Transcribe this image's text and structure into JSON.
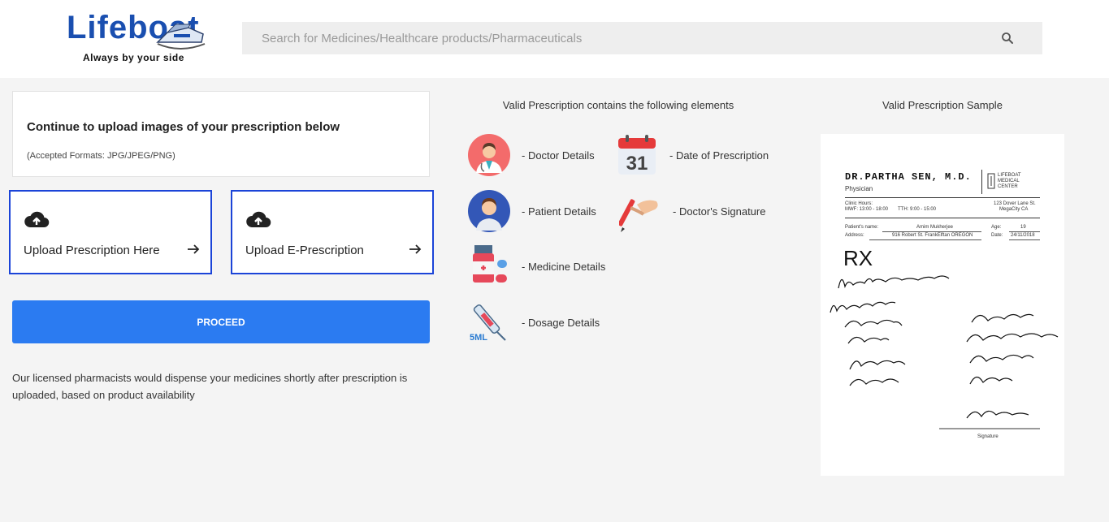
{
  "brand": {
    "name": "Lifeboat",
    "tagline": "Always by your side",
    "color": "#1a4fb0"
  },
  "search": {
    "placeholder": "Search for Medicines/Healthcare products/Pharmaceuticals",
    "icon": "search-icon"
  },
  "upload": {
    "heading": "Continue to upload images of your prescription below",
    "formats": "(Accepted Formats: JPG/JPEG/PNG)",
    "buttons": [
      {
        "label": "Upload Prescription Here",
        "icon": "cloud-upload-icon"
      },
      {
        "label": "Upload E-Prescription",
        "icon": "cloud-upload-icon"
      }
    ],
    "proceed_label": "PROCEED",
    "note": "Our licensed pharmacists would dispense your medicines shortly after prescription is uploaded, based on product availability"
  },
  "elements": {
    "title": "Valid Prescription contains the following elements",
    "items": [
      {
        "label": "- Doctor Details",
        "icon": "doctor-icon"
      },
      {
        "label": "- Date of Prescription",
        "icon": "calendar-icon",
        "calendar_day": "31"
      },
      {
        "label": "- Patient Details",
        "icon": "patient-icon"
      },
      {
        "label": "- Doctor's Signature",
        "icon": "pen-signature-icon"
      },
      {
        "label": "- Medicine Details",
        "icon": "medicine-icon"
      },
      {
        "label": "- Dosage Details",
        "icon": "syringe-icon",
        "dose_label": "5ML"
      }
    ]
  },
  "sample": {
    "title": "Valid Prescription Sample",
    "doctor_name": "DR.PARTHA SEN, M.D.",
    "doctor_role": "Physician",
    "center": [
      "LIFEBOAT",
      "MEDICAL",
      "CENTER"
    ],
    "clinic_hours_label": "Clinic Hours:",
    "hours_mwf": "MWF: 13:00 - 18:00",
    "hours_tth": "TTH: 9:00 - 15:00",
    "address_line1": "123 Dover Lane St.",
    "address_line2": "MegaCity CA",
    "patient_name_label": "Patient's name:",
    "patient_name": "Amim Mukherjee",
    "age_label": "Age:",
    "age": "19",
    "address_label": "Address:",
    "patient_address": "916 Robert St. FrankElftan OREGON",
    "date_label": "Date:",
    "date": "24/11/2018",
    "rx": "RX",
    "signature_label": "Signature"
  }
}
